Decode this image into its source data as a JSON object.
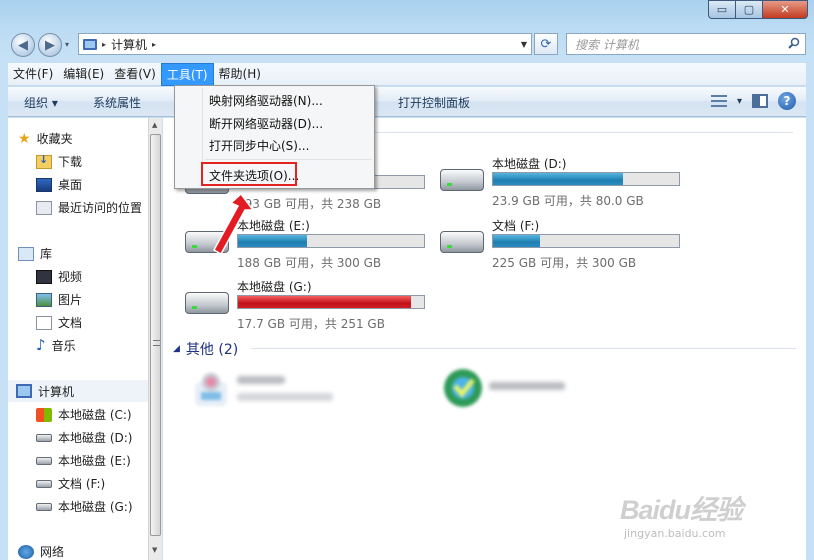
{
  "window": {
    "nav_dropdown_glyph": "▾",
    "address": {
      "segments": [
        "计算机"
      ],
      "sep": "▸"
    },
    "search_placeholder": "搜索 计算机",
    "controls": {
      "min": "▭",
      "max": "▢",
      "close": "✕"
    }
  },
  "menubar": {
    "items": [
      "文件(F)",
      "编辑(E)",
      "查看(V)",
      "工具(T)",
      "帮助(H)"
    ],
    "active": "工具(T)"
  },
  "toolbar": {
    "organize": "组织 ▾",
    "system_properties": "系统属性",
    "control_panel": "打开控制面板",
    "view_dropdown": "▾",
    "help": "?"
  },
  "tools_menu": {
    "items": [
      "映射网络驱动器(N)...",
      "断开网络驱动器(D)...",
      "打开同步中心(S)...",
      "文件夹选项(O)..."
    ],
    "highlighted": "文件夹选项(O)..."
  },
  "nav": {
    "favorites": "收藏夹",
    "fav_items": [
      "下载",
      "桌面",
      "最近访问的位置"
    ],
    "libraries": "库",
    "lib_items": [
      "视频",
      "图片",
      "文档",
      "音乐"
    ],
    "computer": "计算机",
    "drives": [
      "本地磁盘 (C:)",
      "本地磁盘 (D:)",
      "本地磁盘 (E:)",
      "文档 (F:)",
      "本地磁盘 (G:)"
    ],
    "network": "网络"
  },
  "content": {
    "drives": [
      {
        "name": "",
        "used_fraction": 0.19,
        "info": "193 GB 可用，共 238 GB",
        "status_color": "#1f7fb1"
      },
      {
        "name": "本地磁盘 (D:)",
        "used_fraction": 0.7,
        "info": "23.9 GB 可用，共 80.0 GB",
        "status_color": "#1f7fb1"
      },
      {
        "name": "本地磁盘 (E:)",
        "used_fraction": 0.37,
        "info": "188 GB 可用，共 300 GB",
        "status_color": "#1f7fb1"
      },
      {
        "name": "文档 (F:)",
        "used_fraction": 0.25,
        "info": "225 GB 可用，共 300 GB",
        "status_color": "#1f7fb1"
      },
      {
        "name": "本地磁盘 (G:)",
        "used_fraction": 0.93,
        "info": "17.7 GB 可用，共 251 GB",
        "status_color": "#c3121a"
      }
    ],
    "other_group": "其他 (2)",
    "other_toggle": "◢"
  },
  "watermark": {
    "logo": "Baidu经验",
    "url": "jingyan.baidu.com"
  }
}
